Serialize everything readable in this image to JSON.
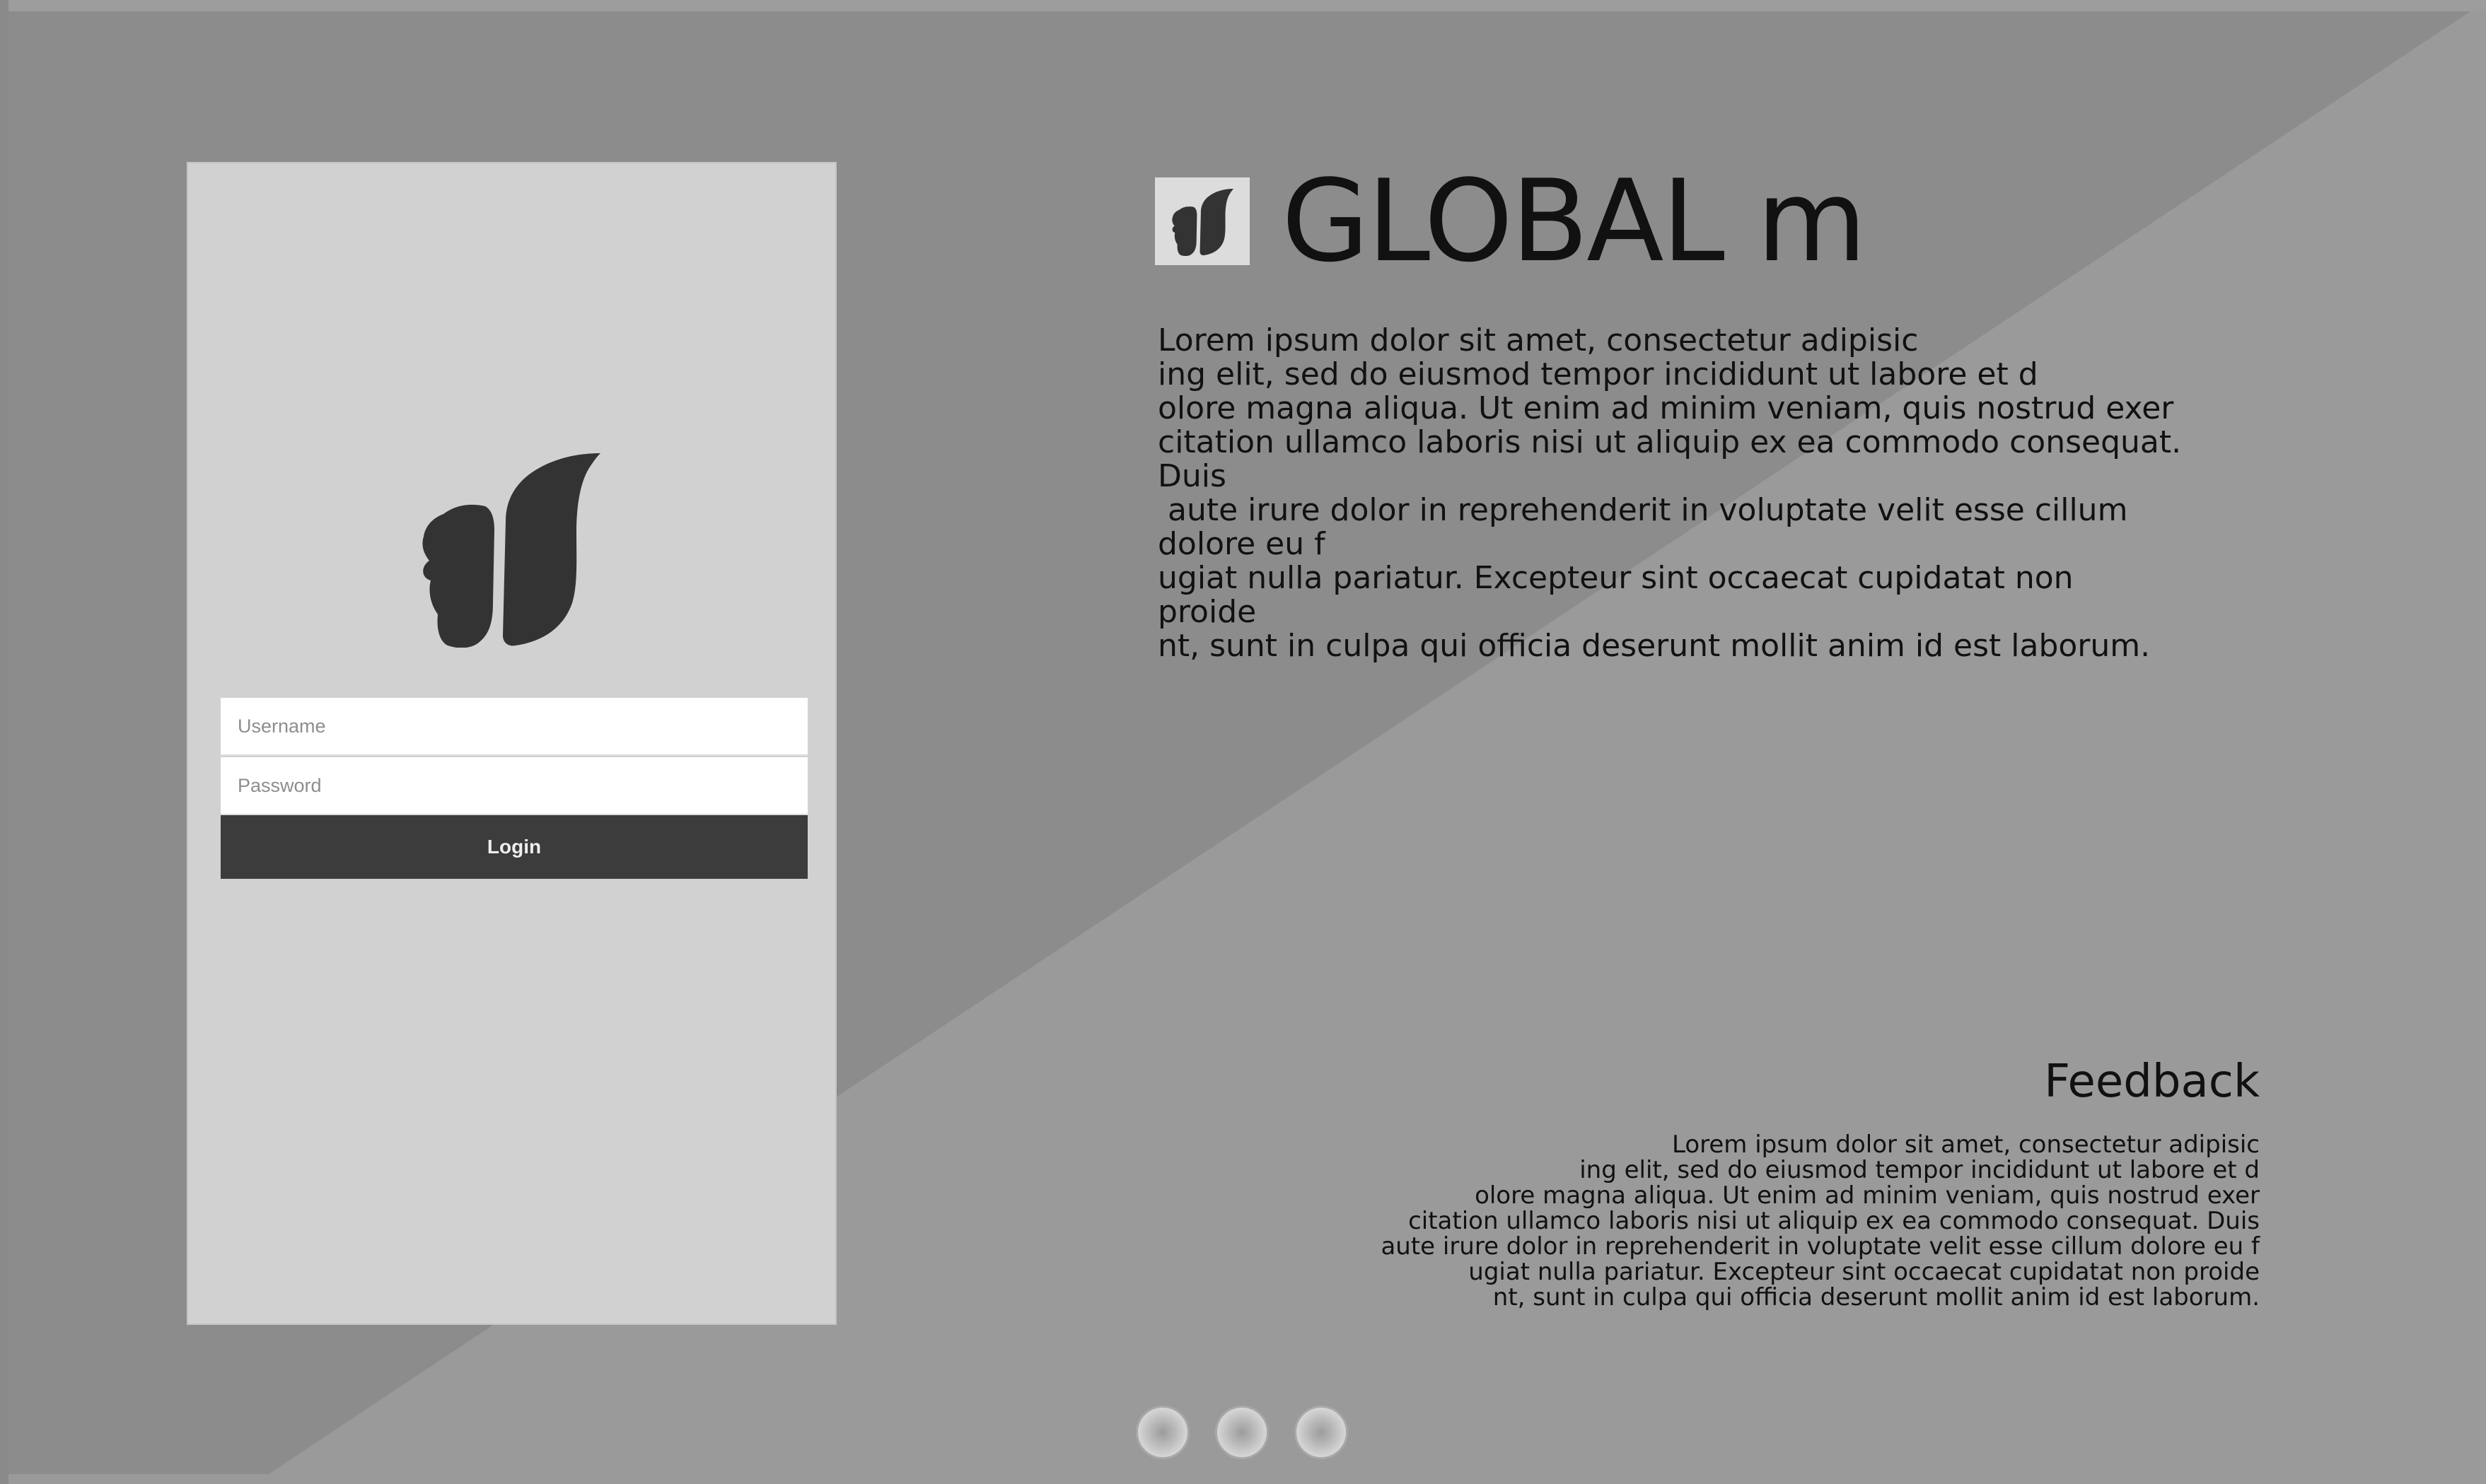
{
  "login": {
    "username_placeholder": "Username",
    "password_placeholder": "Password",
    "login_label": "Login"
  },
  "header": {
    "title": "GLOBAL m"
  },
  "intro": {
    "text": "Lorem ipsum dolor sit amet, consectetur adipisic\ning elit, sed do eiusmod tempor incididunt ut labore et d\nolore magna aliqua. Ut enim ad minim veniam, quis nostrud exer\ncitation ullamco laboris nisi ut aliquip ex ea commodo consequat.\nDuis\n aute irure dolor in reprehenderit in voluptate velit esse cillum\ndolore eu f\nugiat nulla pariatur. Excepteur sint occaecat cupidatat non\nproide\nnt, sunt in culpa qui officia deserunt mollit anim id est laborum."
  },
  "feedback": {
    "title": "Feedback",
    "text": "Lorem ipsum dolor sit amet, consectetur adipisic\ning elit, sed do eiusmod tempor incididunt ut labore et d\nolore magna aliqua. Ut enim ad minim veniam, quis nostrud exer\ncitation ullamco laboris nisi ut aliquip ex ea commodo consequat. Duis\naute irure dolor in reprehenderit in voluptate velit esse cillum dolore eu f\nugiat nulla pariatur. Excepteur sint occaecat cupidatat non proide\nnt, sunt in culpa qui officia deserunt mollit anim id est laborum."
  },
  "slider": {
    "dots": 3
  },
  "icons": {
    "logo": "squirrel-logo-icon"
  },
  "colors": {
    "background_light": "#9a9a9a",
    "background_dark": "#8c8c8c",
    "panel": "#d1d1d1",
    "button": "#3c3c3c",
    "logo": "#333333",
    "text": "#111111"
  }
}
